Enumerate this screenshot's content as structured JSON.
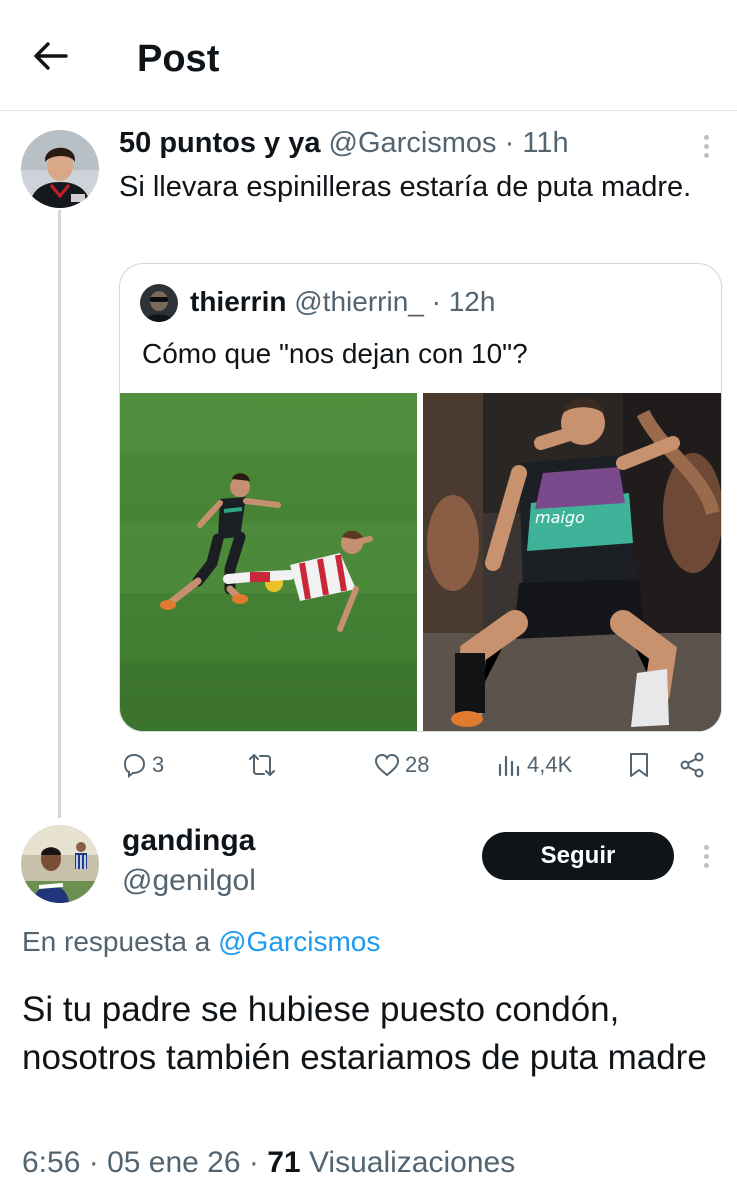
{
  "header": {
    "title": "Post"
  },
  "tweet": {
    "display_name": "50 puntos y ya",
    "handle": "@Garcismos",
    "separator": "·",
    "time": "11h",
    "text": "Si llevara espinilleras estaría de puta madre.",
    "quote": {
      "display_name": "thierrin",
      "handle": "@thierrin_",
      "separator": "·",
      "time": "12h",
      "text": "Cómo que \"nos dejan con 10\"?"
    },
    "actions": {
      "replies": "3",
      "likes": "28",
      "views": "4,4K"
    }
  },
  "reply": {
    "display_name": "gandinga",
    "handle": "@genilgol",
    "follow_label": "Seguir",
    "reply_prefix": "En respuesta a",
    "reply_to": "@Garcismos",
    "text": "Si tu padre se hubiese puesto condón, nosotros también estariamos de puta madre",
    "time": "6:56",
    "date": "05 ene 26",
    "separator": "·",
    "views_count": "71",
    "views_label": "Visualizaciones"
  },
  "icons": [
    "back-arrow-icon",
    "more-icon",
    "reply-icon",
    "retweet-icon",
    "like-icon",
    "views-icon",
    "bookmark-icon",
    "share-icon"
  ],
  "colors": {
    "link": "#1d9bf0",
    "muted": "#536471",
    "text": "#0f1419",
    "follow_bg": "#0f1419"
  }
}
